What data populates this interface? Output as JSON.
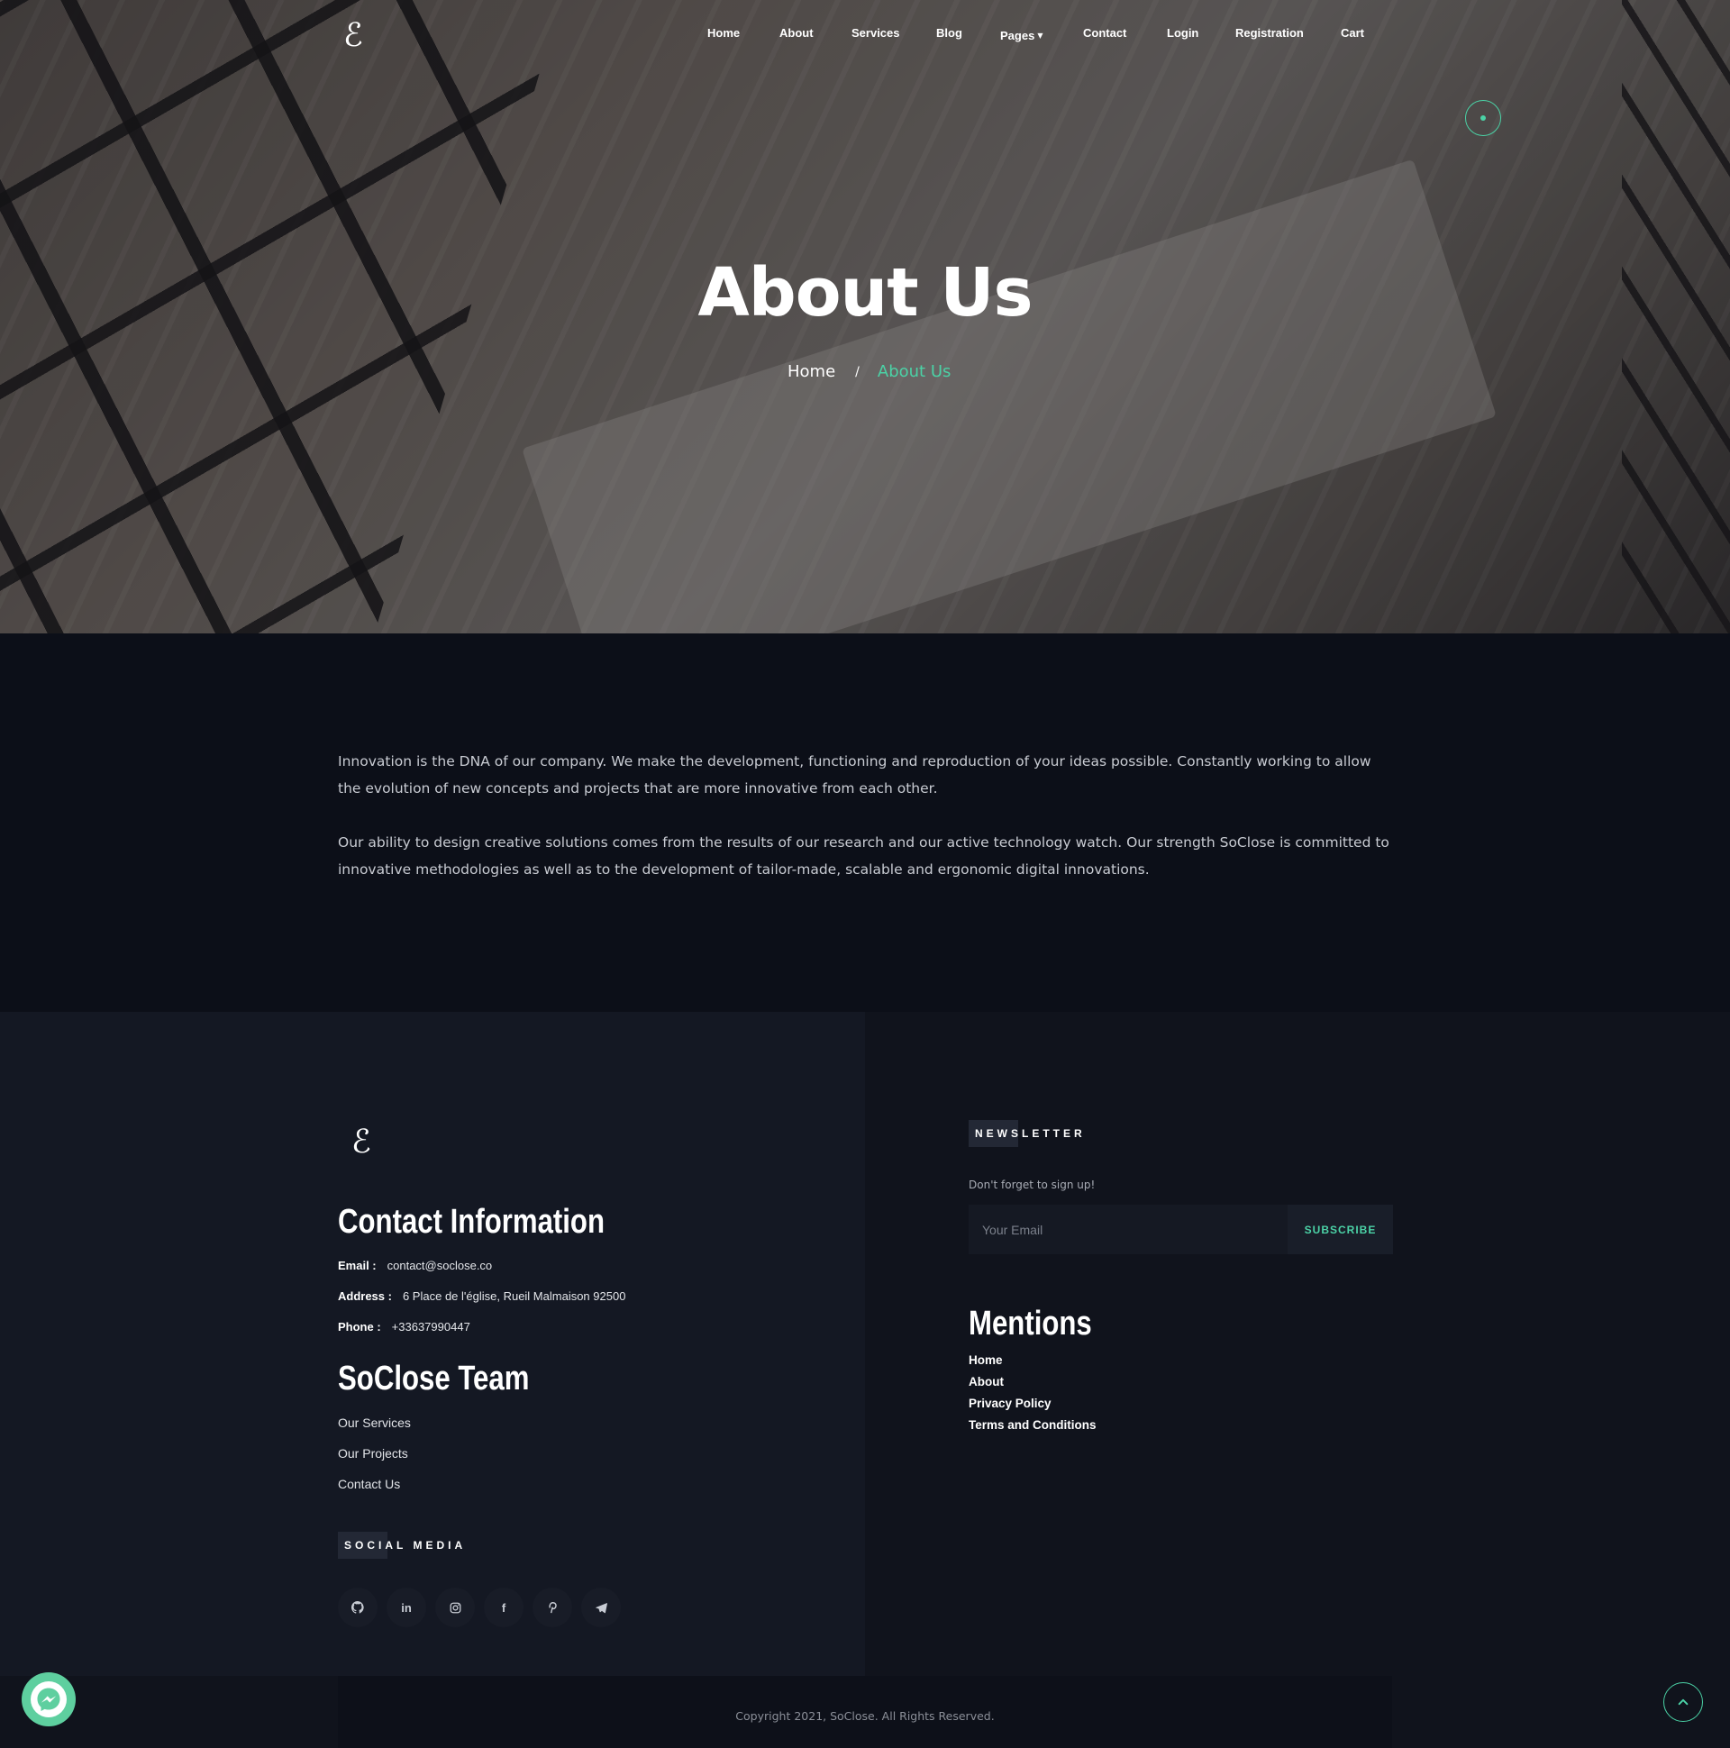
{
  "header": {
    "logo": "ℰ",
    "nav": [
      "Home",
      "About",
      "Services",
      "Blog",
      "Pages",
      "Contact",
      "Login",
      "Registration",
      "Cart"
    ]
  },
  "hero": {
    "title": "About Us",
    "breadcrumb": {
      "home": "Home",
      "separator": "/",
      "current": "About Us"
    }
  },
  "about": {
    "paragraphs": [
      "Innovation is the DNA of our company. We make the development, functioning and reproduction of your ideas possible. Constantly working to allow the evolution of new concepts and projects that are more innovative from each other.",
      "Our ability to design creative solutions comes from the results of our research and our active technology watch. Our strength SoClose is committed to innovative methodologies as well as to the development of tailor-made, scalable and ergonomic digital innovations."
    ]
  },
  "footer": {
    "logo": "ℰ",
    "contact": {
      "title": "Contact Information",
      "email_label": "Email :",
      "email": "contact@soclose.co",
      "address_label": "Address :",
      "address": "6 Place de l'église, Rueil Malmaison 92500",
      "phone_label": "Phone :",
      "phone": "+33637990447"
    },
    "team": {
      "title": "SoClose Team",
      "links": [
        "Our Services",
        "Our Projects",
        "Contact Us"
      ]
    },
    "social": {
      "label": "SOCIAL MEDIA",
      "icons": [
        "github-icon",
        "linkedin-icon",
        "instagram-icon",
        "facebook-icon",
        "pinterest-icon",
        "telegram-icon"
      ]
    },
    "newsletter": {
      "label": "NEWSLETTER",
      "hint": "Don't forget to sign up!",
      "placeholder": "Your Email",
      "button": "SUBSCRIBE"
    },
    "mentions": {
      "title": "Mentions",
      "links": [
        "Home",
        "About",
        "Privacy Policy",
        "Terms and Conditions"
      ]
    },
    "copyright": "Copyright 2021, SoClose. All Rights Reserved."
  },
  "colors": {
    "accent": "#4bd2a6",
    "background": "#0c0f18",
    "footer": "#141823"
  }
}
